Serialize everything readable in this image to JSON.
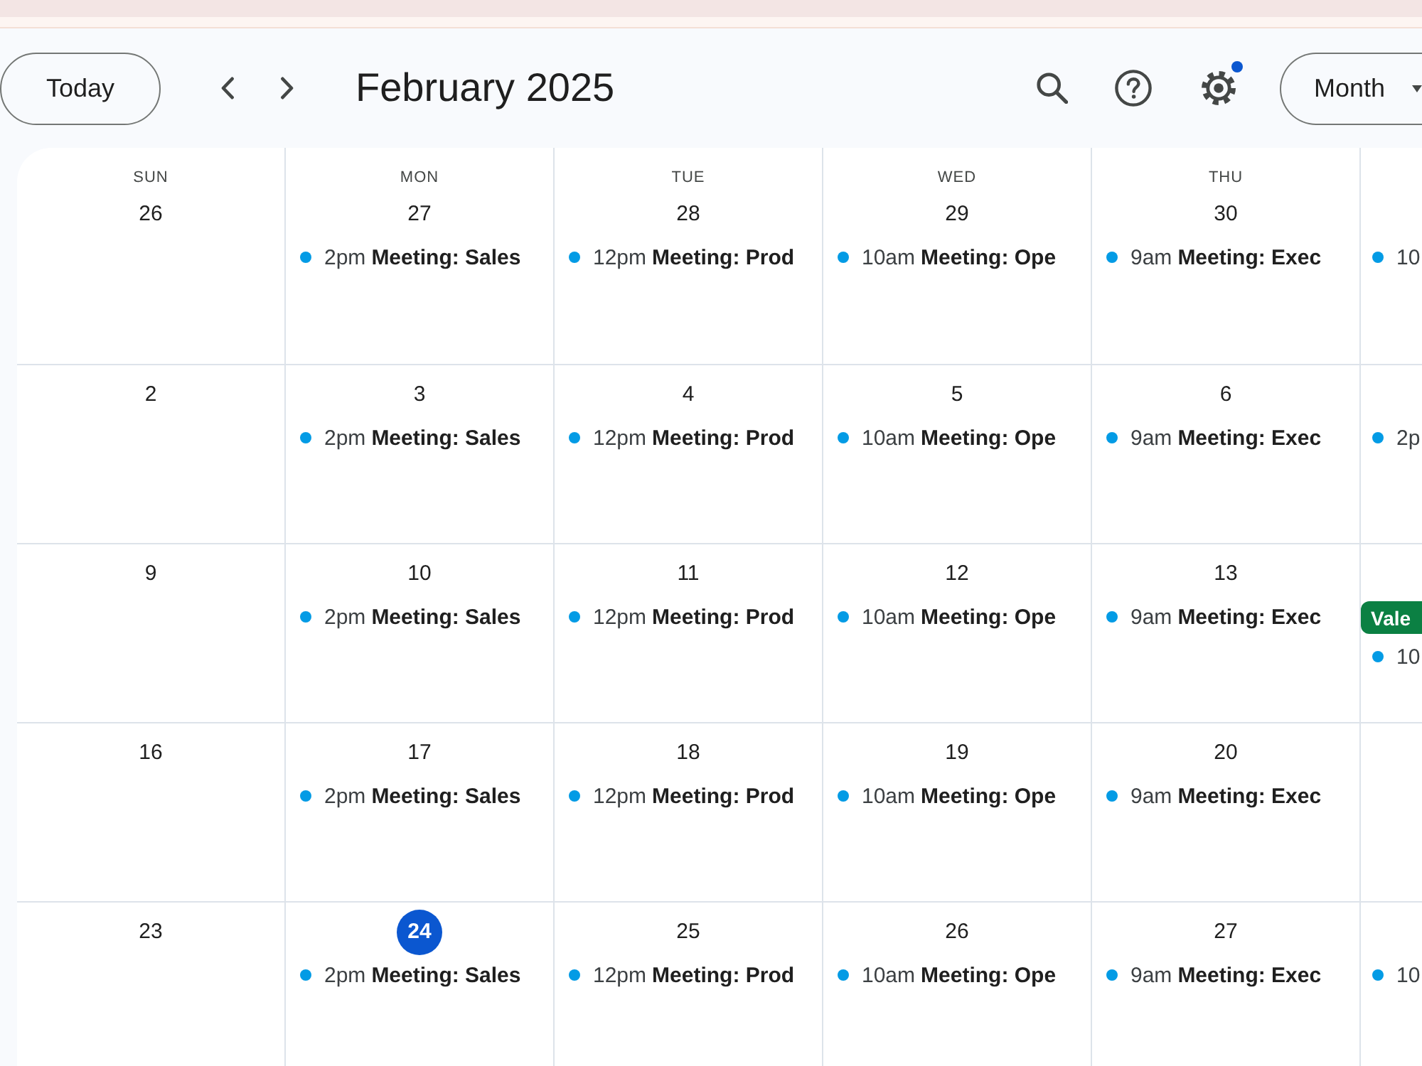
{
  "toolbar": {
    "today_button": "Today",
    "title": "February 2025",
    "settings_notification": true,
    "view_button": "Month"
  },
  "calendar": {
    "weekdays": [
      "SUN",
      "MON",
      "TUE",
      "WED",
      "THU"
    ],
    "weeks": [
      {
        "days": [
          {
            "date": "26",
            "today": false
          },
          {
            "date": "27",
            "today": false,
            "events": [
              {
                "kind": "timed",
                "time": "2pm",
                "title": "Meeting: Sales",
                "color": "#039be5"
              }
            ]
          },
          {
            "date": "28",
            "today": false,
            "events": [
              {
                "kind": "timed",
                "time": "12pm",
                "title": "Meeting: Prod",
                "color": "#039be5"
              }
            ]
          },
          {
            "date": "29",
            "today": false,
            "events": [
              {
                "kind": "timed",
                "time": "10am",
                "title": "Meeting: Ope",
                "color": "#039be5"
              }
            ]
          },
          {
            "date": "30",
            "today": false,
            "events": [
              {
                "kind": "timed",
                "time": "9am",
                "title": "Meeting: Exec",
                "color": "#039be5"
              }
            ]
          }
        ],
        "partial_day": {
          "events": [
            {
              "kind": "timed",
              "time": "10",
              "color": "#039be5"
            }
          ]
        }
      },
      {
        "days": [
          {
            "date": "2",
            "today": false
          },
          {
            "date": "3",
            "today": false,
            "events": [
              {
                "kind": "timed",
                "time": "2pm",
                "title": "Meeting: Sales",
                "color": "#039be5"
              }
            ]
          },
          {
            "date": "4",
            "today": false,
            "events": [
              {
                "kind": "timed",
                "time": "12pm",
                "title": "Meeting: Prod",
                "color": "#039be5"
              }
            ]
          },
          {
            "date": "5",
            "today": false,
            "events": [
              {
                "kind": "timed",
                "time": "10am",
                "title": "Meeting: Ope",
                "color": "#039be5"
              }
            ]
          },
          {
            "date": "6",
            "today": false,
            "events": [
              {
                "kind": "timed",
                "time": "9am",
                "title": "Meeting: Exec",
                "color": "#039be5"
              }
            ]
          }
        ],
        "partial_day": {
          "events": [
            {
              "kind": "timed",
              "time": "2p",
              "color": "#039be5"
            }
          ]
        }
      },
      {
        "days": [
          {
            "date": "9",
            "today": false
          },
          {
            "date": "10",
            "today": false,
            "events": [
              {
                "kind": "timed",
                "time": "2pm",
                "title": "Meeting: Sales",
                "color": "#039be5"
              }
            ]
          },
          {
            "date": "11",
            "today": false,
            "events": [
              {
                "kind": "timed",
                "time": "12pm",
                "title": "Meeting: Prod",
                "color": "#039be5"
              }
            ]
          },
          {
            "date": "12",
            "today": false,
            "events": [
              {
                "kind": "timed",
                "time": "10am",
                "title": "Meeting: Ope",
                "color": "#039be5"
              }
            ]
          },
          {
            "date": "13",
            "today": false,
            "events": [
              {
                "kind": "timed",
                "time": "9am",
                "title": "Meeting: Exec",
                "color": "#039be5"
              }
            ]
          }
        ],
        "partial_day": {
          "events": [
            {
              "kind": "all_day",
              "title": "Vale",
              "color": "#0b8043"
            },
            {
              "kind": "timed",
              "time": "10",
              "color": "#039be5"
            }
          ]
        }
      },
      {
        "days": [
          {
            "date": "16",
            "today": false
          },
          {
            "date": "17",
            "today": false,
            "events": [
              {
                "kind": "timed",
                "time": "2pm",
                "title": "Meeting: Sales",
                "color": "#039be5"
              }
            ]
          },
          {
            "date": "18",
            "today": false,
            "events": [
              {
                "kind": "timed",
                "time": "12pm",
                "title": "Meeting: Prod",
                "color": "#039be5"
              }
            ]
          },
          {
            "date": "19",
            "today": false,
            "events": [
              {
                "kind": "timed",
                "time": "10am",
                "title": "Meeting: Ope",
                "color": "#039be5"
              }
            ]
          },
          {
            "date": "20",
            "today": false,
            "events": [
              {
                "kind": "timed",
                "time": "9am",
                "title": "Meeting: Exec",
                "color": "#039be5"
              }
            ]
          }
        ]
      },
      {
        "days": [
          {
            "date": "23",
            "today": false
          },
          {
            "date": "24",
            "today": true,
            "events": [
              {
                "kind": "timed",
                "time": "2pm",
                "title": "Meeting: Sales",
                "color": "#039be5"
              }
            ]
          },
          {
            "date": "25",
            "today": false,
            "events": [
              {
                "kind": "timed",
                "time": "12pm",
                "title": "Meeting: Prod",
                "color": "#039be5"
              }
            ]
          },
          {
            "date": "26",
            "today": false,
            "events": [
              {
                "kind": "timed",
                "time": "10am",
                "title": "Meeting: Ope",
                "color": "#039be5"
              }
            ]
          },
          {
            "date": "27",
            "today": false,
            "events": [
              {
                "kind": "timed",
                "time": "9am",
                "title": "Meeting: Exec",
                "color": "#039be5"
              }
            ]
          }
        ],
        "partial_day": {
          "events": [
            {
              "kind": "timed",
              "time": "10",
              "color": "#039be5"
            }
          ]
        }
      }
    ]
  }
}
